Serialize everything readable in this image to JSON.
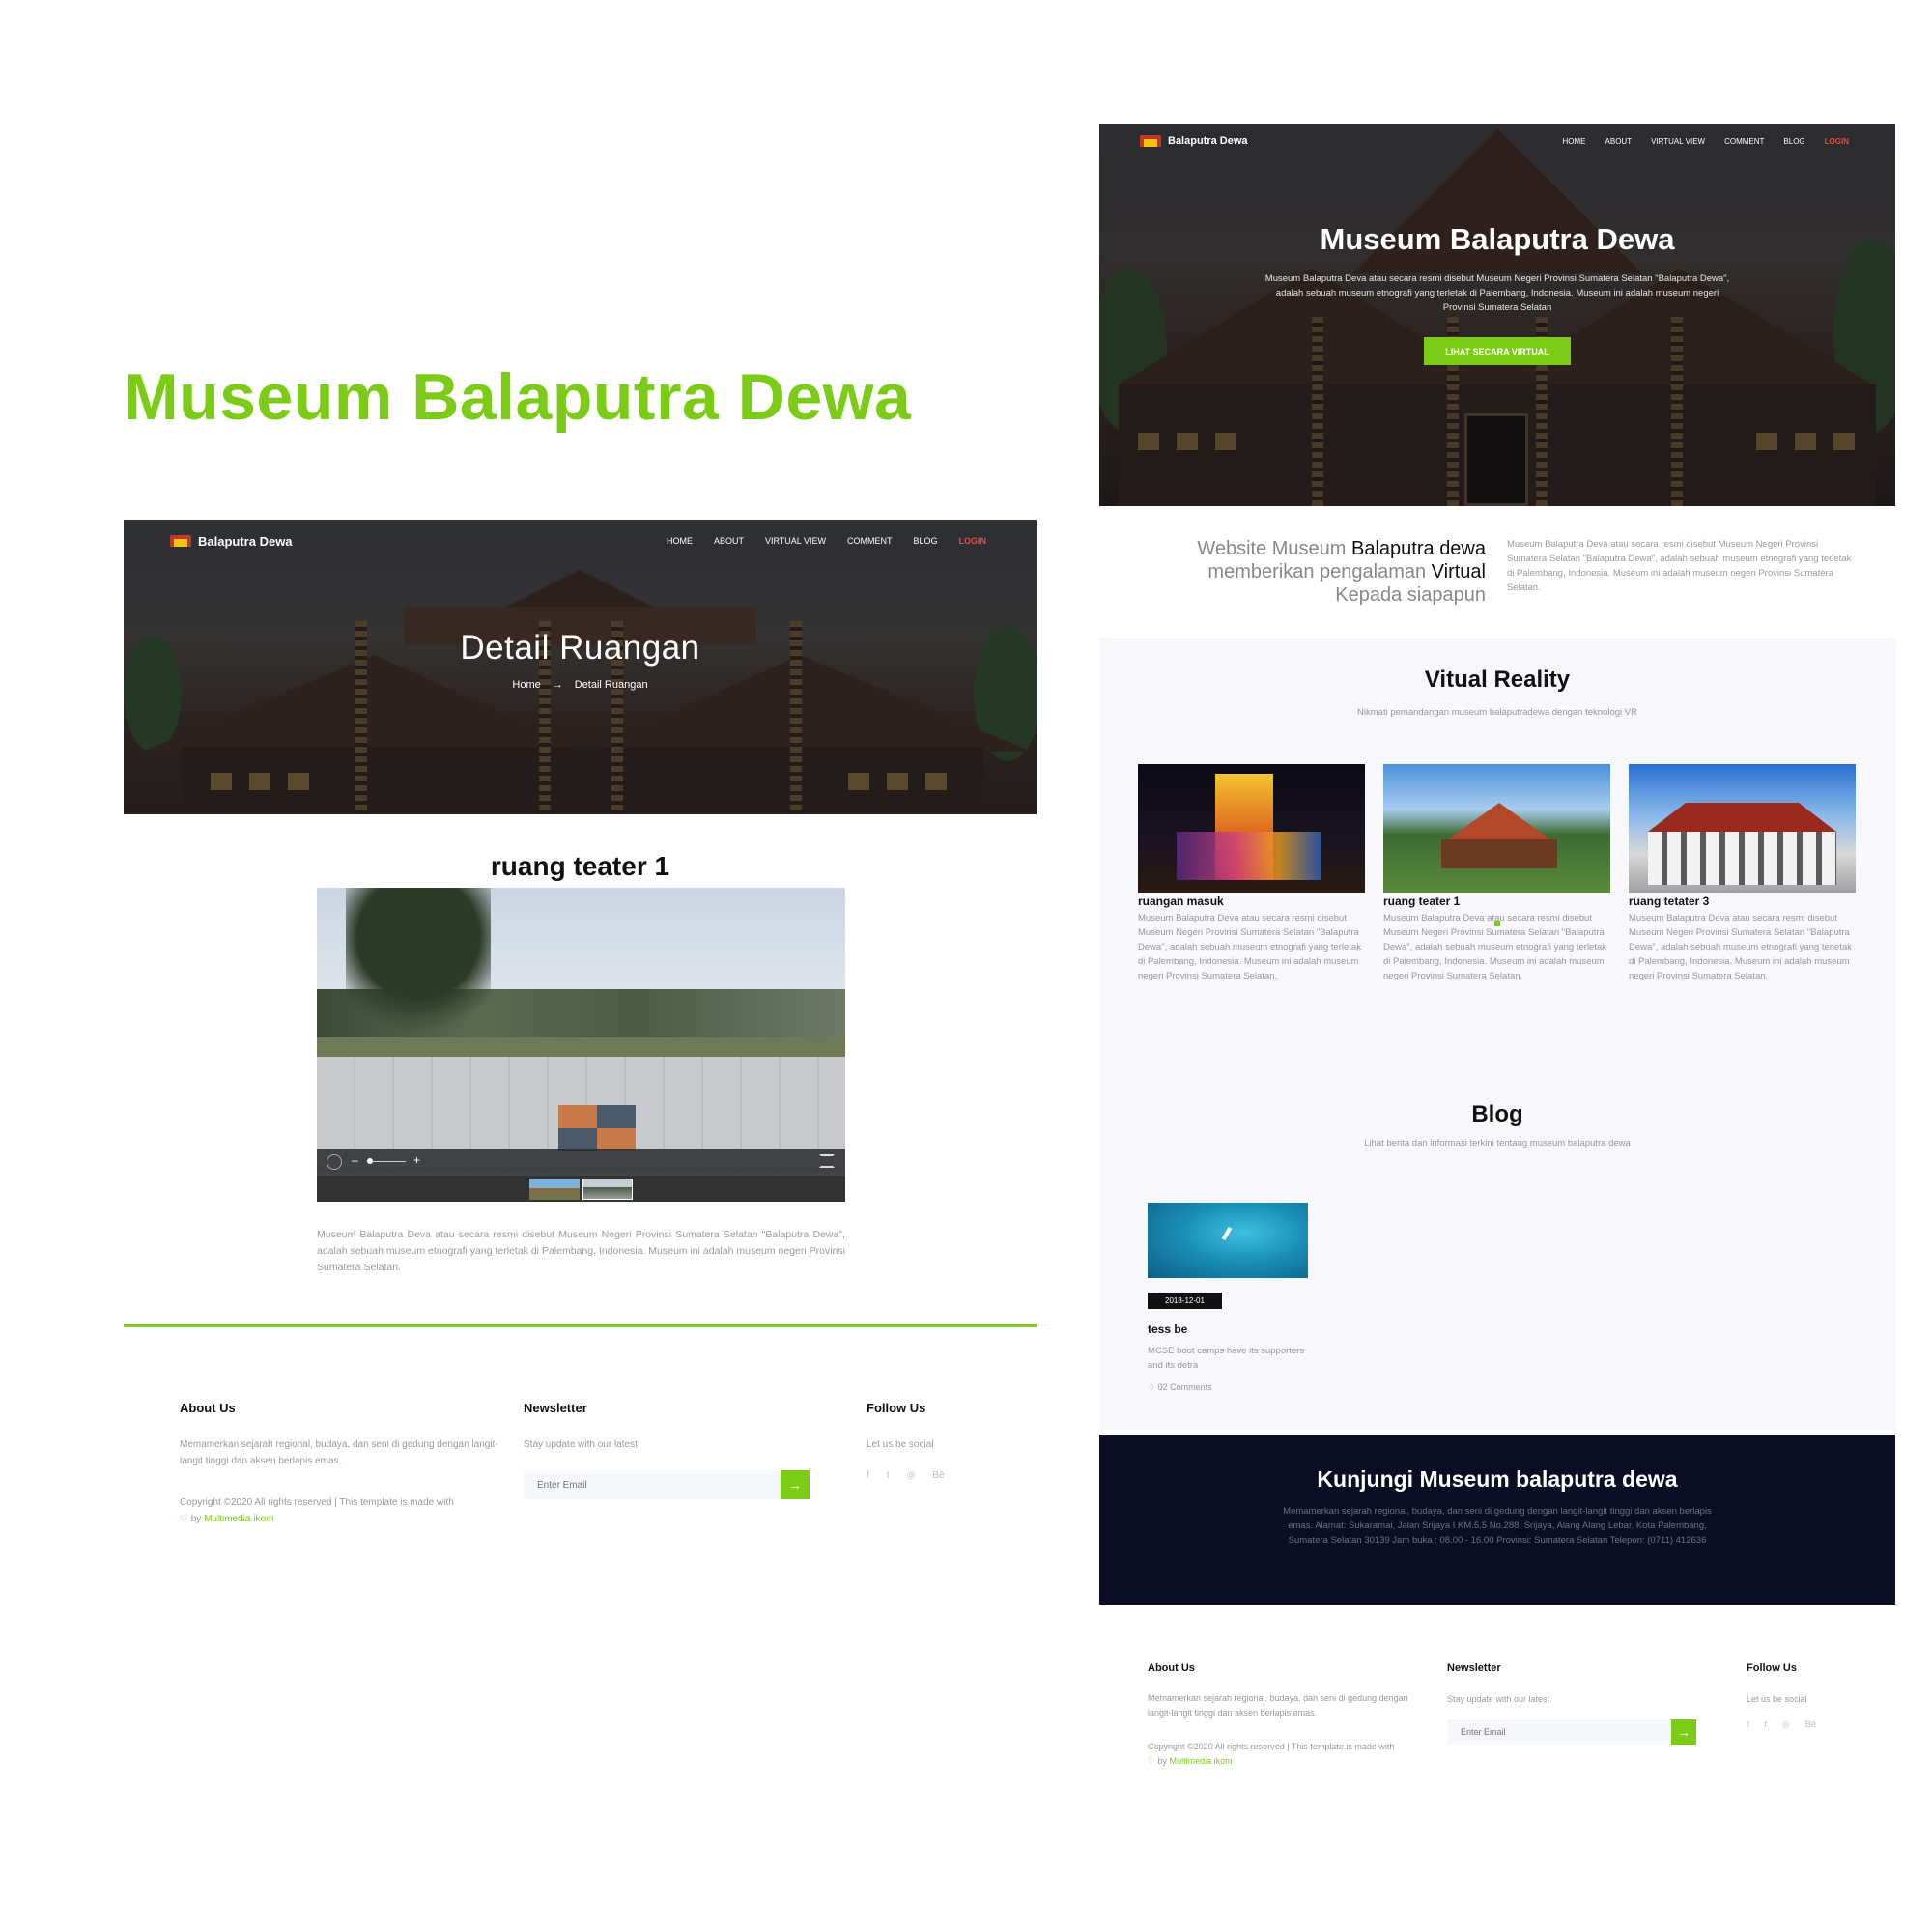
{
  "showcase": {
    "title": "Museum Balaputra Dewa"
  },
  "brand": {
    "name": "Balaputra Dewa"
  },
  "nav": {
    "home": "HOME",
    "about": "ABOUT",
    "virtual": "VIRTUAL VIEW",
    "comment": "COMMENT",
    "blog": "BLOG",
    "login": "LOGIN"
  },
  "detail": {
    "hero_title": "Detail Ruangan",
    "breadcrumb_home": "Home",
    "breadcrumb_arrow": "→",
    "breadcrumb_current": "Detail Ruangan",
    "room_title": "ruang teater 1",
    "room_description": "Museum Balaputra Deva atau secara resmi disebut Museum Negeri Provinsi Sumatera Selatan \"Balaputra Dewa\", adalah sebuah museum etnografi yang terletak di Palembang, Indonesia. Museum ini adalah museum negeri Provinsi Sumatera Selatan.",
    "viewer": {
      "zoom_minus": "–",
      "zoom_plus": "+"
    }
  },
  "home": {
    "hero_title": "Museum Balaputra Dewa",
    "hero_text": "Museum Balaputra Deva atau secara resmi disebut Museum Negeri Provinsi Sumatera Selatan \"Balaputra Dewa\", adalah sebuah museum etnografi yang terletak di Palembang, Indonesia. Museum ini adalah museum negeri Provinsi Sumatera Selatan",
    "hero_button": "LIHAT SECARA VIRTUAL",
    "intro": {
      "l1a": "Website Museum ",
      "l1b": "Balaputra dewa",
      "l2a": "memberikan pengalaman ",
      "l2b": "Virtual",
      "l3": "Kepada siapapun",
      "text": "Museum Balaputra Deva atau secara resmi disebut Museum Negeri Provinsi Sumatera Selatan \"Balaputra Dewa\", adalah sebuah museum etnografi yang terletak di Palembang, Indonesia. Museum ini adalah museum negeri Provinsi Sumatera Selatan."
    },
    "vr": {
      "title": "Vitual Reality",
      "subtitle": "Nikmati pemandangan museum balaputradewa dengan teknologi VR",
      "cards": [
        {
          "title": "ruangan masuk",
          "text": "Museum Balaputra Deva atau secara resmi disebut Museum Negeri Provinsi Sumatera Selatan \"Balaputra Dewa\", adalah sebuah museum etnografi yang terletak di Palembang, Indonesia. Museum ini adalah museum negeri Provinsi Sumatera Selatan."
        },
        {
          "title": "ruang teater 1",
          "text": "Museum Balaputra Deva atau secara resmi disebut Museum Negeri Provinsi Sumatera Selatan \"Balaputra Dewa\", adalah sebuah museum etnografi yang terletak di Palembang, Indonesia. Museum ini adalah museum negeri Provinsi Sumatera Selatan."
        },
        {
          "title": "ruang tetater 3",
          "text": "Museum Balaputra Deva atau secara resmi disebut Museum Negeri Provinsi Sumatera Selatan \"Balaputra Dewa\", adalah sebuah museum etnografi yang terletak di Palembang, Indonesia. Museum ini adalah museum negeri Provinsi Sumatera Selatan."
        }
      ]
    },
    "blog": {
      "title": "Blog",
      "subtitle": "Lihat berita dan informasi terkini tentang museum balaputra dewa",
      "post": {
        "date": "2018-12-01",
        "title": "tess be",
        "excerpt": "MCSE boot camps have its supporters and its detra",
        "comments": "02 Comments"
      }
    },
    "visit": {
      "title": "Kunjungi Museum balaputra dewa",
      "text": "Memamerkan sejarah regional, budaya, dan seni di gedung dengan langit-langit tinggi dan aksen berlapis emas. Alamat: Sukaramai, Jalan Srijaya I KM.5.5 No.288, Srijaya, Alang Alang Lebar, Kota Palembang, Sumatera Selatan 30139 Jam buka : 08.00 - 16.00 Provinsi: Sumatera Selatan Telepon: (0711) 412636"
    }
  },
  "footer": {
    "about_title": "About Us",
    "about_text": "Memamerkan sejarah regional, budaya, dan seni di gedung dengan langit-langit tinggi dan aksen berlapis emas.",
    "copyright": "Copyright ©2020 All rights reserved | This template is made with",
    "by": " by ",
    "author": "Multimedia ikom",
    "newsletter_title": "Newsletter",
    "newsletter_text": "Stay update with our latest",
    "email_placeholder": "Enter Email",
    "follow_title": "Follow Us",
    "follow_text": "Let us be social",
    "social": [
      "f",
      "t",
      "◎",
      "Bē"
    ]
  },
  "colors": {
    "accent": "#7ccb16",
    "login": "#e74c3c",
    "dark_band": "#0b0d24"
  }
}
